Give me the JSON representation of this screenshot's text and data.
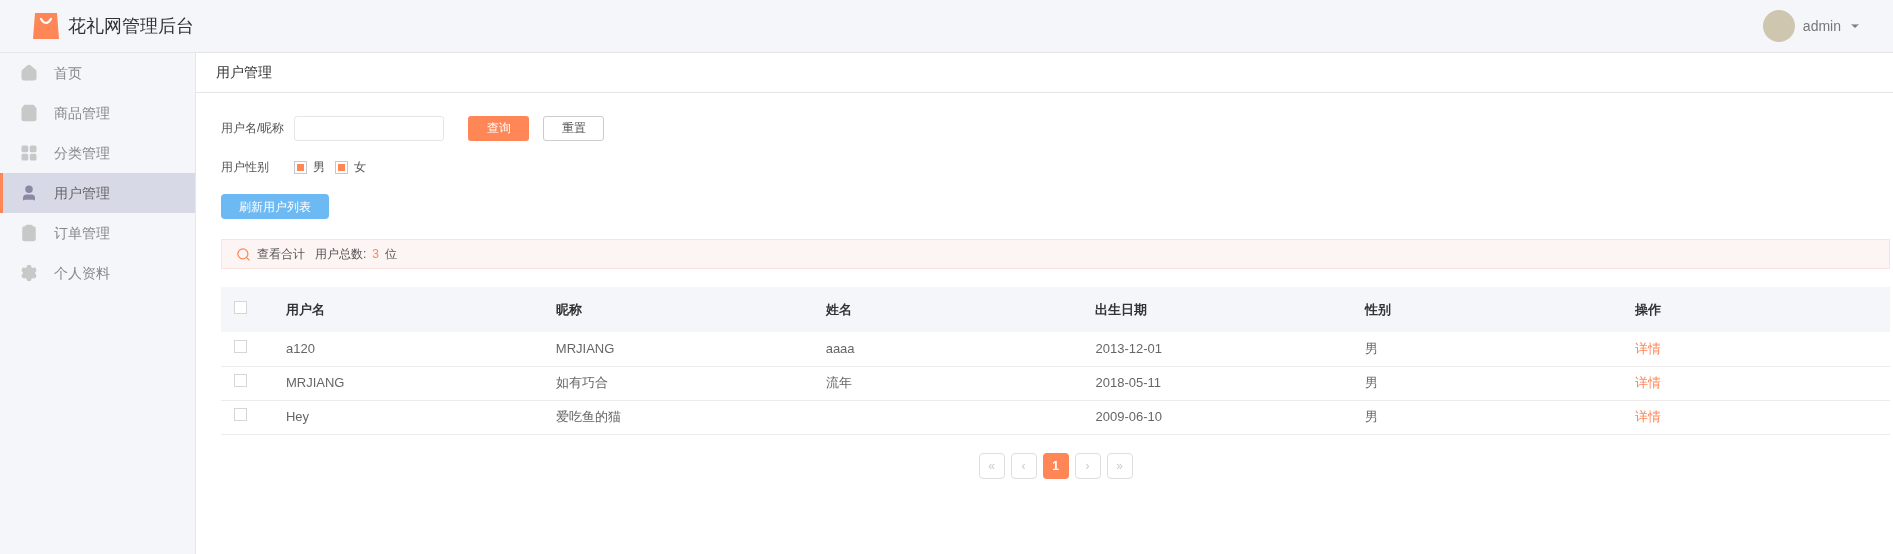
{
  "header": {
    "title": "花礼网管理后台",
    "user": "admin"
  },
  "sidebar": {
    "items": [
      {
        "label": "首页",
        "selected": false
      },
      {
        "label": "商品管理",
        "selected": false
      },
      {
        "label": "分类管理",
        "selected": false
      },
      {
        "label": "用户管理",
        "selected": true
      },
      {
        "label": "订单管理",
        "selected": false
      },
      {
        "label": "个人资料",
        "selected": false
      }
    ]
  },
  "breadcrumb": "用户管理",
  "filters": {
    "name_label": "用户名/昵称",
    "query_button": "查询",
    "reset_button": "重置",
    "gender_label": "用户性别",
    "genders": [
      {
        "label": "男",
        "checked": true
      },
      {
        "label": "女",
        "checked": true
      }
    ],
    "refresh_button": "刷新用户列表"
  },
  "summary": {
    "label": "查看合计",
    "text": "用户总数:",
    "count": "3",
    "unit": "位"
  },
  "table": {
    "columns": [
      "用户名",
      "昵称",
      "姓名",
      "出生日期",
      "性别",
      "操作"
    ],
    "rows": [
      {
        "checked": false,
        "cells": [
          "a120",
          "MRJIANG",
          "aaaa",
          "2013-12-01",
          "男"
        ],
        "action": "详情"
      },
      {
        "checked": false,
        "cells": [
          "MRJIANG",
          "如有巧合",
          "流年",
          "2018-05-11",
          "男"
        ],
        "action": "详情"
      },
      {
        "checked": false,
        "cells": [
          "Hey",
          "爱吃鱼的猫",
          "",
          "2009-06-10",
          "男"
        ],
        "action": "详情"
      }
    ],
    "all_checked": false
  },
  "pagination": [
    {
      "label": "«",
      "selected": false
    },
    {
      "label": "‹",
      "selected": false
    },
    {
      "label": "1",
      "selected": true
    },
    {
      "label": "›",
      "selected": false
    },
    {
      "label": "»",
      "selected": false
    }
  ]
}
